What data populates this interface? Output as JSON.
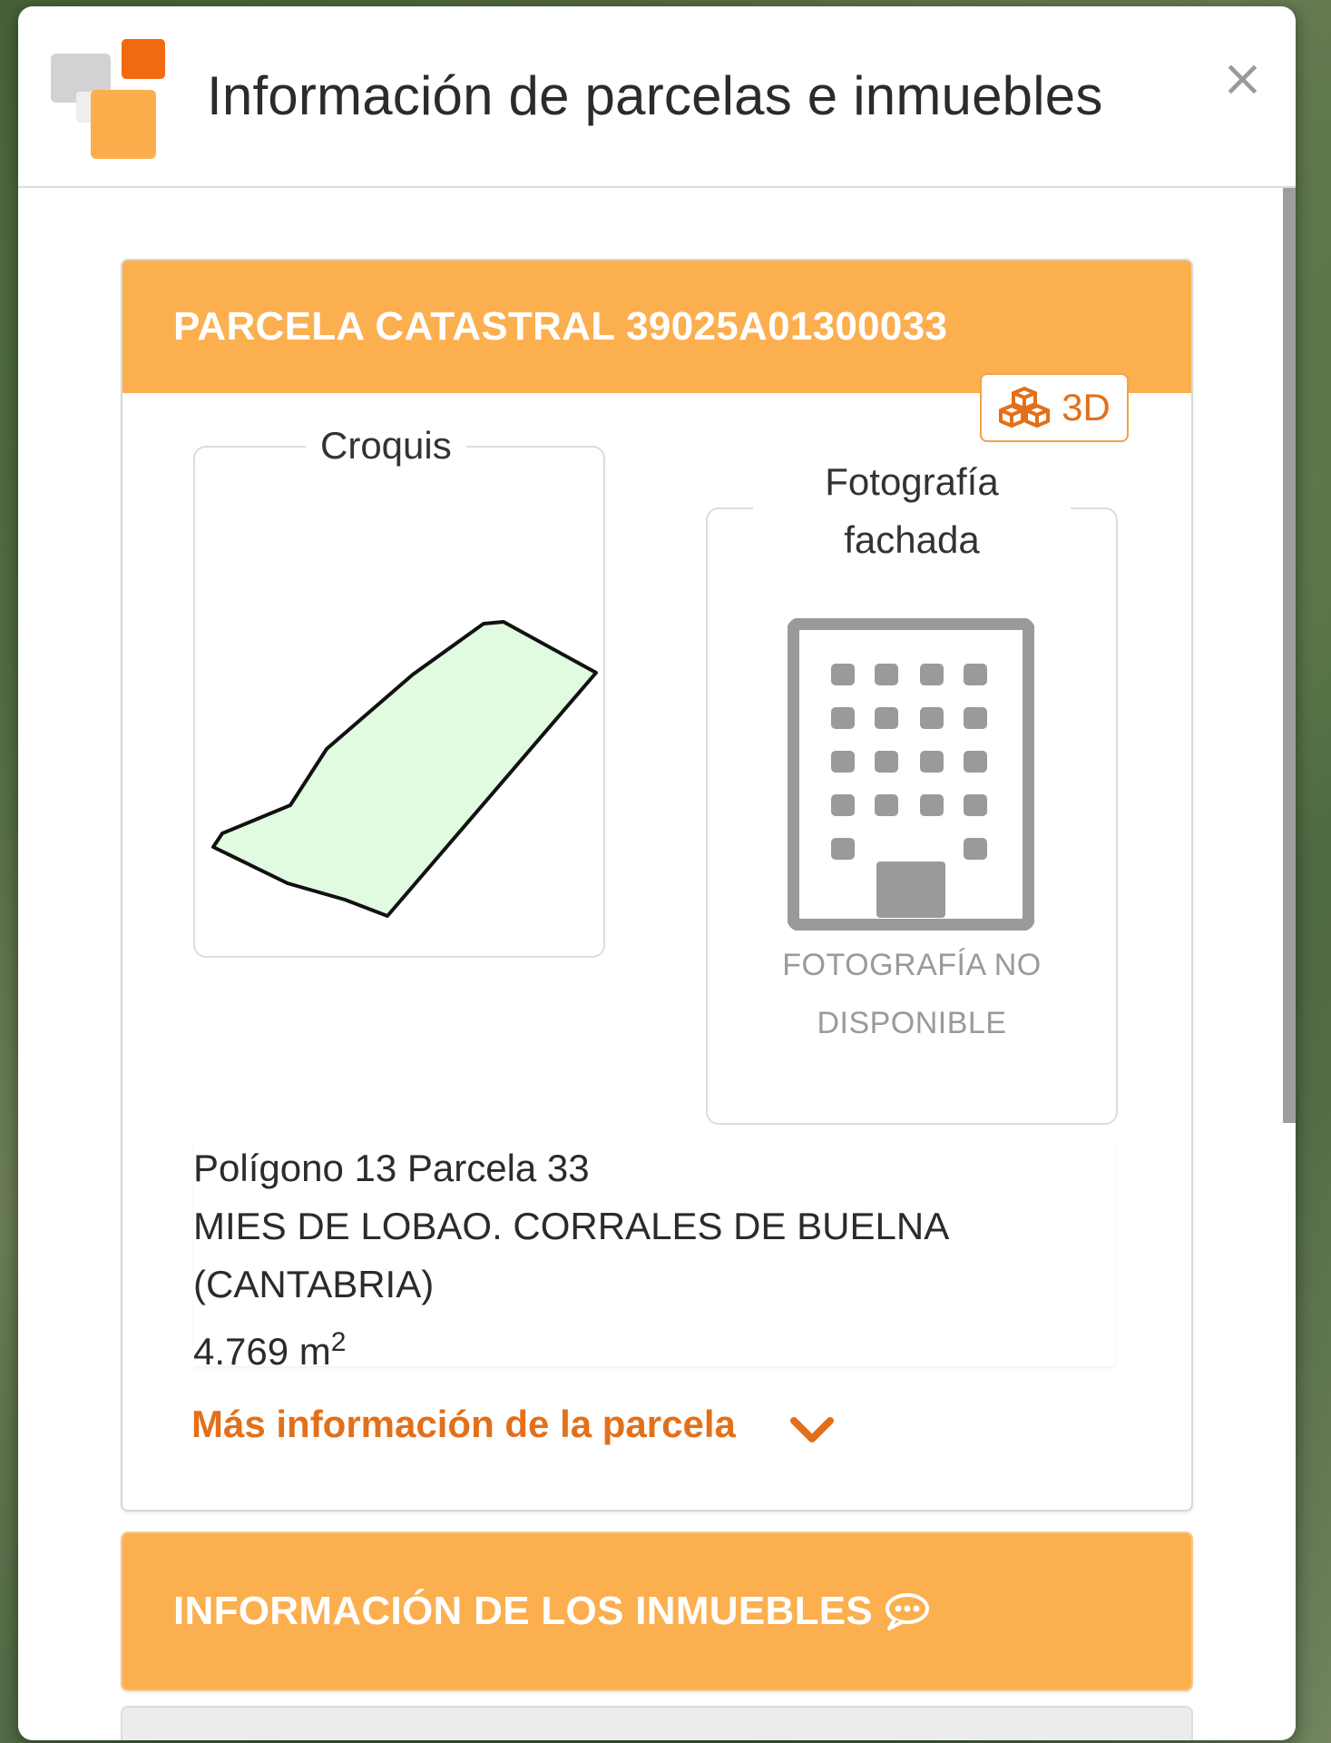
{
  "colors": {
    "accent": "#fbaf4f",
    "link": "#e2701a",
    "parcel_fill": "#e0fbe0",
    "placeholder_gray": "#9a9a9a"
  },
  "modal": {
    "title": "Información de parcelas e inmuebles",
    "close_label": "×"
  },
  "parcel": {
    "header": "PARCELA CATASTRAL 39025A01300033",
    "btn_3d_label": "3D",
    "croquis_label": "Croquis",
    "photo_label_line1": "Fotografía",
    "photo_label_line2": "fachada",
    "photo_missing_line1": "FOTOGRAFÍA NO",
    "photo_missing_line2": "DISPONIBLE",
    "location": "Polígono 13 Parcela 33",
    "address_line1": "MIES DE LOBAO. CORRALES DE BUELNA",
    "address_line2": "(CANTABRIA)",
    "area_value": "4.769 m",
    "area_exponent": "2",
    "more_info_label": "Más información de la parcela"
  },
  "inmuebles": {
    "header": "INFORMACIÓN DE LOS INMUEBLES"
  },
  "icons": {
    "logo": "catastro-logo-icon",
    "close": "close-icon",
    "three_d": "cubes-icon",
    "building": "building-icon",
    "chevron": "chevron-down-icon",
    "comment": "comment-icon"
  }
}
